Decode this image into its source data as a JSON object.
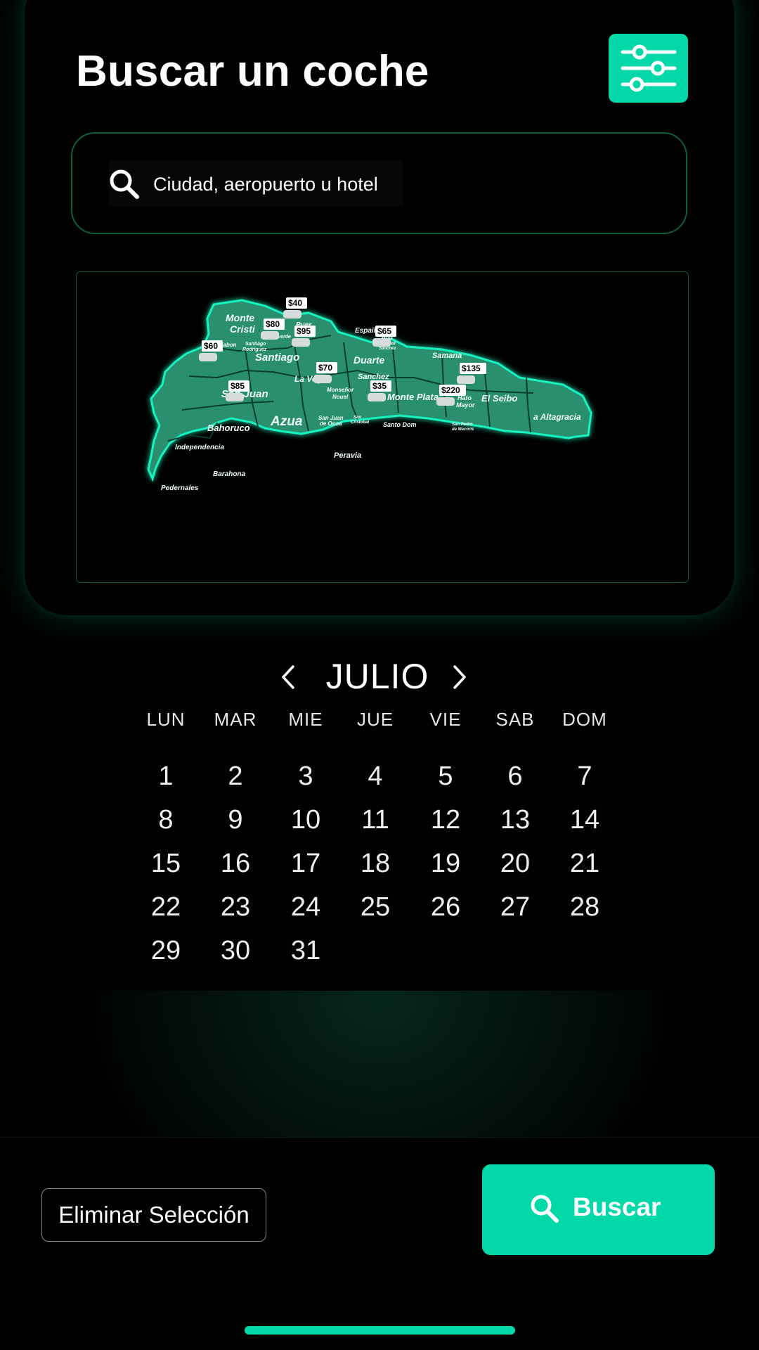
{
  "header": {
    "title": "Buscar un coche",
    "filter_icon": "sliders-icon"
  },
  "search": {
    "placeholder": "Ciudad, aeropuerto u hotel",
    "value": "",
    "icon": "search-icon"
  },
  "map": {
    "regions": [
      "Monte Cristi",
      "Dajabón",
      "Santiago Rodríguez",
      "Valverde",
      "Puerto Plata",
      "Espaillat",
      "María Trinidad Sánchez",
      "Santiago",
      "Duarte",
      "Samaná",
      "La Vega",
      "Sánchez Ramírez",
      "Monseñor Nouel",
      "Monte Plata",
      "Hato Mayor",
      "El Seibo",
      "La Altagracia",
      "San Juan",
      "Azua",
      "San Juan de Ocoa",
      "San Cristóbal",
      "Santo Domingo",
      "San Pedro de Macorís",
      "Bahoruco",
      "Independencia",
      "Barahona",
      "Pedernales",
      "Peravia"
    ],
    "price_tags": [
      "$40",
      "$80",
      "$95",
      "$65",
      "$60",
      "$70",
      "$85",
      "$35",
      "$135",
      "$220"
    ]
  },
  "calendar": {
    "month": "JULIO",
    "prev_icon": "chevron-left-icon",
    "next_icon": "chevron-right-icon",
    "weekdays": [
      "LUN",
      "MAR",
      "MIE",
      "JUE",
      "VIE",
      "SAB",
      "DOM"
    ],
    "weeks": [
      [
        "1",
        "2",
        "3",
        "4",
        "5",
        "6",
        "7"
      ],
      [
        "8",
        "9",
        "10",
        "11",
        "12",
        "13",
        "14"
      ],
      [
        "15",
        "16",
        "17",
        "18",
        "19",
        "20",
        "21"
      ],
      [
        "22",
        "23",
        "24",
        "25",
        "26",
        "27",
        "28"
      ],
      [
        "29",
        "30",
        "31"
      ]
    ]
  },
  "actions": {
    "clear_label": "Eliminar Selección",
    "search_label": "Buscar",
    "search_icon": "search-icon"
  },
  "colors": {
    "accent": "#02d8a8",
    "background": "#000000",
    "map_fill": "#2a8f6e",
    "map_glow": "#19f2c0"
  }
}
